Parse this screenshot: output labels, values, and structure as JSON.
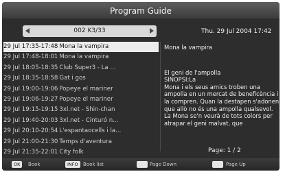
{
  "header": {
    "title": "Program Guide"
  },
  "channel": {
    "name": "002 K3/33"
  },
  "clock": {
    "datetime": "Thu.   29 Jul 2004 17:42"
  },
  "programs": [
    {
      "time": "29 Jul 17:35-17:48",
      "title": "Mona la vampira"
    },
    {
      "time": "29 Jul 17:48-18:01",
      "title": "Mona la vampira"
    },
    {
      "time": "29 Jul 18:05-18:35",
      "title": "Club Super3 - La ..."
    },
    {
      "time": "29 Jul 18:35-18:58",
      "title": "Gat i gos"
    },
    {
      "time": "29 Jul 19:00-19:06",
      "title": "Popeye el mariner"
    },
    {
      "time": "29 Jul 19:06-19:27",
      "title": "Popeye el mariner"
    },
    {
      "time": "29 Jul 19:15-19:15",
      "title": "3xl.net - Shin-chan"
    },
    {
      "time": "29 Jul 19:40-20:03",
      "title": "3xl.net - Cinturó n..."
    },
    {
      "time": "29 Jul 20:10-20:54",
      "title": "L'espantaocells i la..."
    },
    {
      "time": "29 Jul 21:00-21:30",
      "title": "Temps d'aventura"
    },
    {
      "time": "29 Jul 21:35-22:01",
      "title": "City folk"
    }
  ],
  "detail": {
    "program_name": "Mona la vampira",
    "episode_title": "El geni de l'ampolla",
    "synopsis_label": "SINOPSI:La",
    "synopsis": "Mona i els seus amics troben una ampolla en un mercat de beneficència i la compren. Quan la destapen s'adonen que allò no és una ampolla qualsevol. La Mona se'n veurà de tots colors per atrapar el geni malvat, que",
    "page": "Page: 1 / 2"
  },
  "footer": {
    "ok_key": "OK",
    "ok_label": "Book",
    "info_key": "INFO",
    "info_label": "Book list",
    "page_down_label": "Page Down",
    "page_up_label": "Page Up"
  },
  "colors": {
    "background": "#2d2d2d",
    "selected_row": "#ececec",
    "text": "#f0f0f0"
  }
}
